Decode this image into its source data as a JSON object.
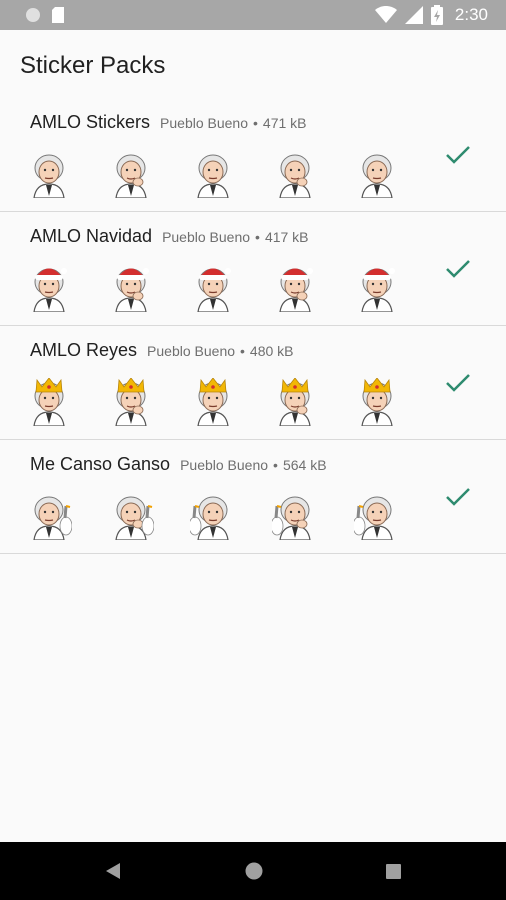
{
  "status_bar": {
    "time": "2:30",
    "icons": [
      "notification-circle-icon",
      "sd-card-icon",
      "wifi-icon",
      "signal-icon",
      "battery-charging-icon"
    ]
  },
  "header": {
    "title": "Sticker Packs"
  },
  "packs": [
    {
      "name": "AMLO Stickers",
      "publisher": "Pueblo Bueno",
      "separator": "•",
      "size": "471 kB",
      "hat": "none",
      "added_icon": "check-icon",
      "sticker_count": 5
    },
    {
      "name": "AMLO Navidad",
      "publisher": "Pueblo Bueno",
      "separator": "•",
      "size": "417 kB",
      "hat": "santa",
      "added_icon": "check-icon",
      "sticker_count": 5
    },
    {
      "name": "AMLO Reyes",
      "publisher": "Pueblo Bueno",
      "separator": "•",
      "size": "480 kB",
      "hat": "crown",
      "added_icon": "check-icon",
      "sticker_count": 5
    },
    {
      "name": "Me Canso Ganso",
      "publisher": "Pueblo Bueno",
      "separator": "•",
      "size": "564 kB",
      "hat": "goose",
      "added_icon": "check-icon",
      "sticker_count": 5
    }
  ],
  "nav_bar": {
    "buttons": [
      "back-icon",
      "home-icon",
      "recents-icon"
    ]
  },
  "colors": {
    "status_bar": "#a7a7a7",
    "check": "#2e8b6f",
    "santa_red": "#d32f2f",
    "crown_gold": "#f2b705"
  }
}
